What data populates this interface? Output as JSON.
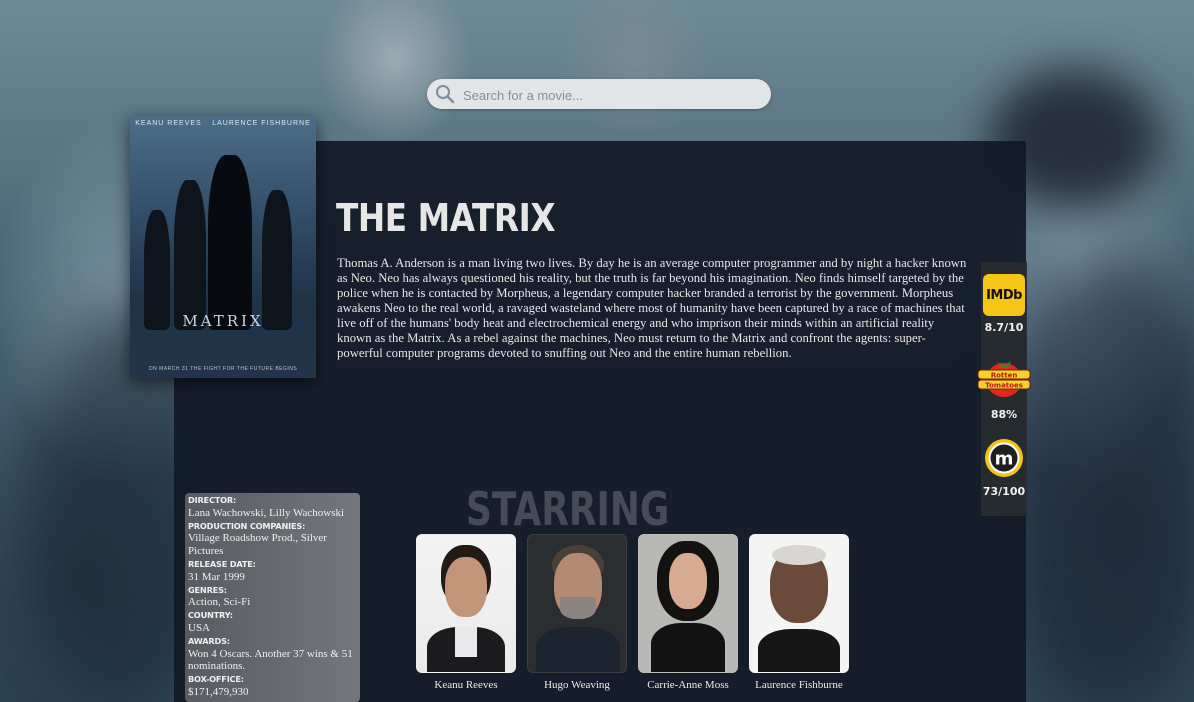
{
  "search": {
    "placeholder": "Search for a movie..."
  },
  "movie": {
    "title": "THE MATRIX",
    "plot": "Thomas A. Anderson is a man living two lives. By day he is an average computer programmer and by night a hacker known as Neo. Neo has always questioned his reality, but the truth is far beyond his imagination. Neo finds himself targeted by the police when he is contacted by Morpheus, a legendary computer hacker branded a terrorist by the government. Morpheus awakens Neo to the real world, a ravaged wasteland where most of humanity have been captured by a race of machines that live off of the humans' body heat and electrochemical energy and who imprison their minds within an artificial reality known as the Matrix. As a rebel against the machines, Neo must return to the Matrix and confront the agents: super-powerful computer programs devoted to snuffing out Neo and the entire human rebellion.",
    "poster": {
      "top_names": [
        "KEANU REEVES",
        "LAURENCE FISHBURNE"
      ],
      "title": "MATRIX",
      "tagline": "ON MARCH 31 THE FIGHT FOR THE FUTURE BEGINS"
    }
  },
  "ratings": {
    "imdb": {
      "logo_text": "IMDb",
      "score": "8.7/10"
    },
    "rotten_tomatoes": {
      "score": "88%"
    },
    "metacritic": {
      "score": "73/100"
    }
  },
  "details": {
    "director_label": "DIRECTOR:",
    "director": "Lana Wachowski, Lilly Wachowski",
    "companies_label": "PRODUCTION COMPANIES:",
    "companies": "Village Roadshow Prod., Silver Pictures",
    "release_label": "RELEASE DATE:",
    "release": "31 Mar 1999",
    "genres_label": "GENRES:",
    "genres": "Action, Sci-Fi",
    "country_label": "COUNTRY:",
    "country": "USA",
    "awards_label": "AWARDS:",
    "awards": "Won 4 Oscars. Another 37 wins & 51 nominations.",
    "boxoffice_label": "BOX-OFFICE:",
    "boxoffice": "$171,479,930"
  },
  "starring": {
    "heading": "STARRING",
    "cast": [
      {
        "name": "Keanu Reeves"
      },
      {
        "name": "Hugo Weaving"
      },
      {
        "name": "Carrie-Anne Moss"
      },
      {
        "name": "Laurence Fishburne"
      }
    ]
  },
  "colors": {
    "panel": "#121a26",
    "imdb": "#f5c518",
    "tomato": "#e0281c",
    "metacritic": "#f2c318"
  }
}
